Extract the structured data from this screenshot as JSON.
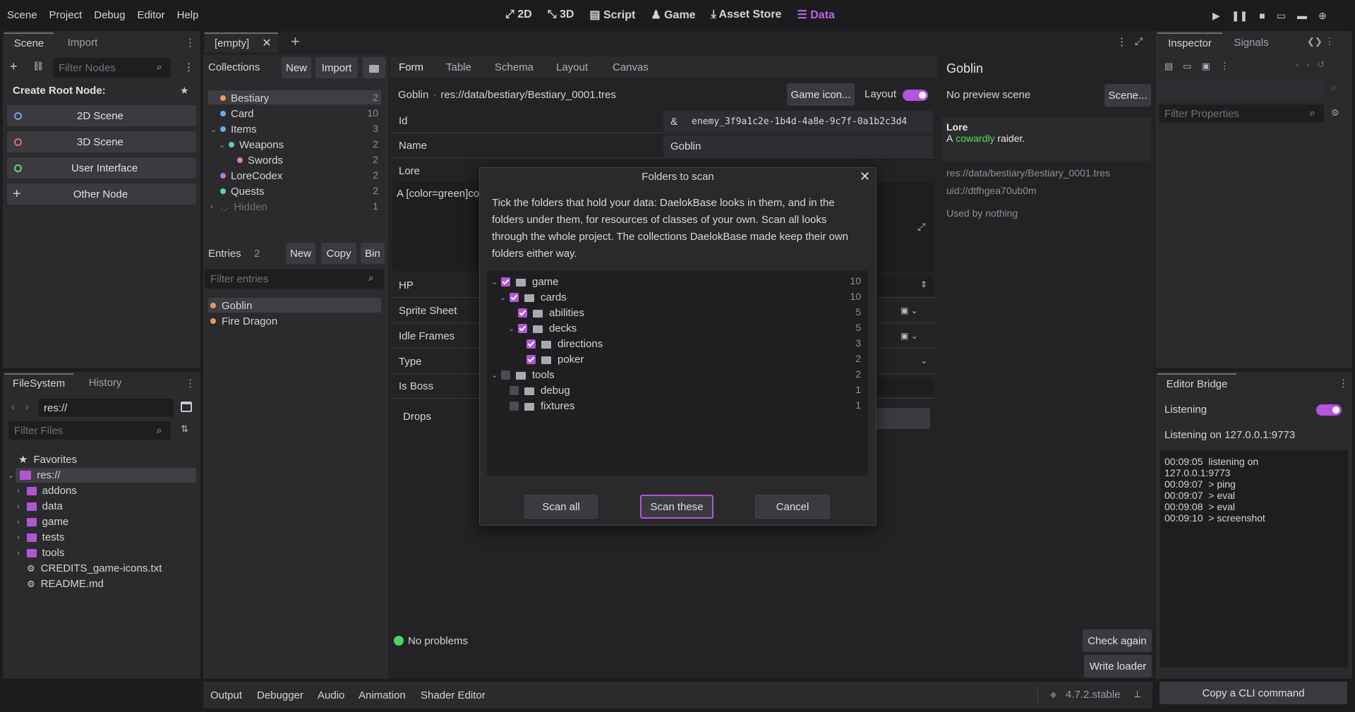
{
  "menu": {
    "scene": "Scene",
    "project": "Project",
    "debug": "Debug",
    "editor": "Editor",
    "help": "Help"
  },
  "workspaces": {
    "d2": "2D",
    "d3": "3D",
    "script": "Script",
    "game": "Game",
    "asset_store": "Asset Store",
    "data": "Data"
  },
  "scene_dock": {
    "tab_scene": "Scene",
    "tab_import": "Import",
    "filter_placeholder": "Filter Nodes",
    "create_root": "Create Root Node:",
    "btn_2d": "2D Scene",
    "btn_3d": "3D Scene",
    "btn_ui": "User Interface",
    "btn_other": "Other Node"
  },
  "fs_dock": {
    "tab_fs": "FileSystem",
    "tab_history": "History",
    "path": "res://",
    "filter_placeholder": "Filter Files",
    "favorites": "Favorites",
    "root": "res://",
    "folders": [
      "addons",
      "data",
      "game",
      "tests",
      "tools"
    ],
    "files": [
      "CREDITS_game-icons.txt",
      "README.md"
    ]
  },
  "editor_tabs": {
    "tab": "[empty]"
  },
  "collections": {
    "title": "Collections",
    "new": "New",
    "import": "Import",
    "items": [
      {
        "name": "Bestiary",
        "count": "2",
        "color": "#e89a5a"
      },
      {
        "name": "Card",
        "count": "10",
        "color": "#6ea8e8"
      },
      {
        "name": "Items",
        "count": "3",
        "color": "#6ea8e8"
      },
      {
        "name": "Weapons",
        "count": "2",
        "color": "#5fd0b5"
      },
      {
        "name": "Swords",
        "count": "2",
        "color": "#e07ab0"
      },
      {
        "name": "LoreCodex",
        "count": "2",
        "color": "#b07ae0"
      },
      {
        "name": "Quests",
        "count": "2",
        "color": "#5fd0b5"
      },
      {
        "name": "Hidden",
        "count": "1"
      }
    ]
  },
  "entries": {
    "title": "Entries",
    "count": "2",
    "new": "New",
    "copy": "Copy",
    "bin": "Bin",
    "filter_placeholder": "Filter entries",
    "items": [
      {
        "name": "Goblin",
        "color": "#e89a5a"
      },
      {
        "name": "Fire Dragon",
        "color": "#e89a5a"
      }
    ]
  },
  "form": {
    "tabs": [
      "Form",
      "Table",
      "Schema",
      "Layout",
      "Canvas"
    ],
    "entry_name": "Goblin",
    "sep": "·",
    "entry_path": "res://data/bestiary/Bestiary_0001.tres",
    "game_icon": "Game icon...",
    "layout": "Layout",
    "id_label": "Id",
    "id_amp": "&",
    "id_value": "enemy_3f9a1c2e-1b4d-4a8e-9c7f-0a1b2c3d4",
    "name_label": "Name",
    "name_value": "Goblin",
    "lore_label": "Lore",
    "lore_value": "A [color=green]co",
    "hp": "HP",
    "sprite_sheet": "Sprite Sheet",
    "idle_frames": "Idle Frames",
    "type": "Type",
    "is_boss": "Is Boss",
    "drops": "Drops",
    "status": "No problems",
    "check_again": "Check again",
    "write_loader": "Write loader"
  },
  "dialog": {
    "title": "Folders to scan",
    "body": "Tick the folders that hold your data: DaelokBase looks in them, and in the folders under them, for resources of classes of your own. Scan all looks through the whole project. The collections DaelokBase made keep their own folders either way.",
    "tree": [
      {
        "name": "game",
        "count": "10",
        "checked": true,
        "depth": 0,
        "arrow": true
      },
      {
        "name": "cards",
        "count": "10",
        "checked": true,
        "depth": 1,
        "arrow": true
      },
      {
        "name": "abilities",
        "count": "5",
        "checked": true,
        "depth": 2,
        "arrow": false
      },
      {
        "name": "decks",
        "count": "5",
        "checked": true,
        "depth": 2,
        "arrow": true
      },
      {
        "name": "directions",
        "count": "3",
        "checked": true,
        "depth": 3,
        "arrow": false
      },
      {
        "name": "poker",
        "count": "2",
        "checked": true,
        "depth": 3,
        "arrow": false
      },
      {
        "name": "tools",
        "count": "2",
        "checked": false,
        "depth": 0,
        "arrow": true
      },
      {
        "name": "debug",
        "count": "1",
        "checked": false,
        "depth": 1,
        "arrow": false
      },
      {
        "name": "fixtures",
        "count": "1",
        "checked": false,
        "depth": 1,
        "arrow": false
      }
    ],
    "scan_all": "Scan all",
    "scan_these": "Scan these",
    "cancel": "Cancel"
  },
  "preview": {
    "title": "Goblin",
    "no_preview": "No preview scene",
    "scene_btn": "Scene...",
    "lore_title": "Lore",
    "lore_a": "A",
    "lore_green": "cowardly",
    "lore_b": "raider.",
    "path": "res://data/bestiary/Bestiary_0001.tres",
    "uid": "uid://dtfhgea70ub0m",
    "used_by": "Used by nothing"
  },
  "inspector": {
    "tab_inspector": "Inspector",
    "tab_signals": "Signals",
    "filter_placeholder": "Filter Properties"
  },
  "bridge": {
    "title": "Editor Bridge",
    "listening": "Listening",
    "listening_on": "Listening on 127.0.0.1:9773",
    "log": [
      "00:09:05  listening on",
      "127.0.0.1:9773",
      "00:09:07  > ping",
      "00:09:07  > eval",
      "00:09:08  > eval",
      "00:09:10  > screenshot"
    ],
    "copy_cli": "Copy a CLI command"
  },
  "bottom": {
    "tabs": [
      "Output",
      "Debugger",
      "Audio",
      "Animation",
      "Shader Editor"
    ],
    "version": "4.7.2.stable"
  },
  "colors": {
    "accent": "#b355dd",
    "green": "#5fdc5f",
    "bg": "#1c1c1f",
    "panel": "#2b2b2e"
  }
}
